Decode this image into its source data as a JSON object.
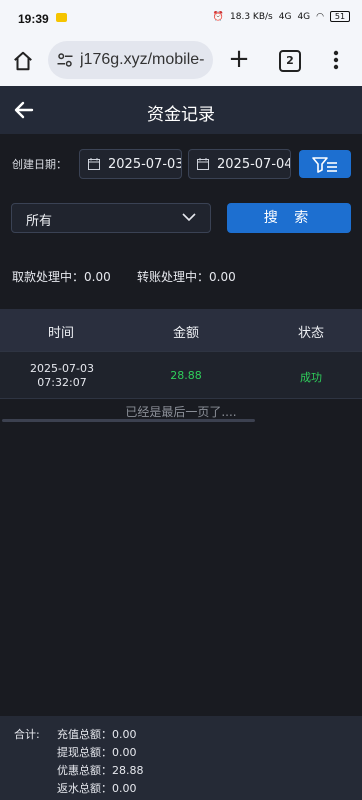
{
  "statusbar": {
    "time": "19:39",
    "net_speed": "18.3 KB/s",
    "net1": "4G",
    "net2": "4G",
    "battery": "51"
  },
  "browser": {
    "url": "j176g.xyz/mobile-",
    "tab_count": "2"
  },
  "header": {
    "title": "资金记录"
  },
  "filters": {
    "date_label": "创建日期：",
    "date_start": "2025-07-03~",
    "date_end": "2025-07-04",
    "select_value": "所有",
    "search_label": "搜 索"
  },
  "processing": {
    "withdraw": "取款处理中：0.00",
    "transfer": "转账处理中：0.00"
  },
  "table": {
    "columns": [
      "时间",
      "金额",
      "状态"
    ],
    "rows": [
      {
        "time_date": "2025-07-03",
        "time_clock": "07:32:07",
        "amount": "28.88",
        "status": "成功"
      }
    ]
  },
  "colors": {
    "accent": "#1d6fd0",
    "success": "#2fcf5b"
  },
  "footer_note": "已经是最后一页了....",
  "totals": {
    "label": "合计:",
    "recharge": "充值总额：0.00",
    "withdraw": "提现总额：0.00",
    "bonus": "优惠总额：28.88",
    "rebate": "返水总额：0.00"
  }
}
